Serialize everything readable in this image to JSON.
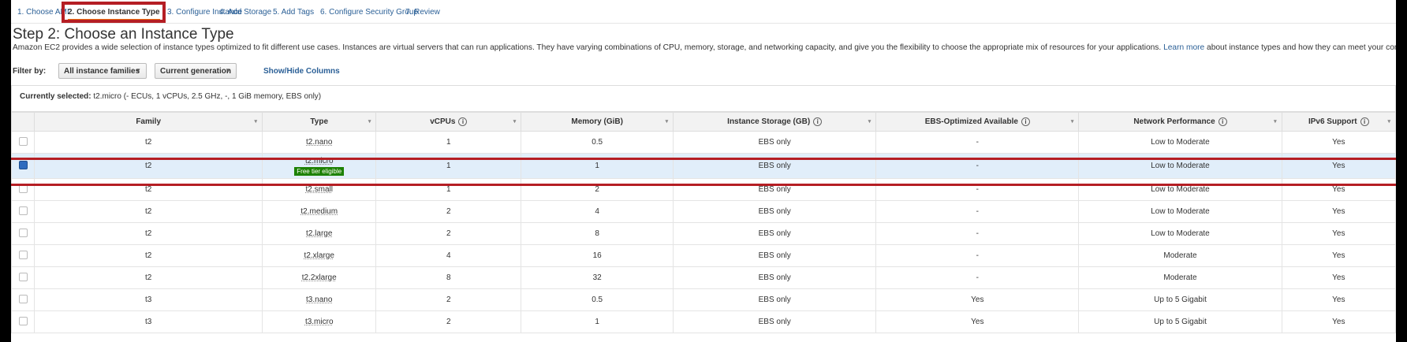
{
  "wizard": {
    "tabs": [
      {
        "label": "1. Choose AMI"
      },
      {
        "label": "2. Choose Instance Type"
      },
      {
        "label": "3. Configure Instance"
      },
      {
        "label": "4. Add Storage"
      },
      {
        "label": "5. Add Tags"
      },
      {
        "label": "6. Configure Security Group"
      },
      {
        "label": "7. Review"
      }
    ],
    "active_index": 1
  },
  "page": {
    "title": "Step 2: Choose an Instance Type",
    "description": "Amazon EC2 provides a wide selection of instance types optimized to fit different use cases. Instances are virtual servers that can run applications. They have varying combinations of CPU, memory, storage, and networking capacity, and give you the flexibility to choose the appropriate mix of resources for your applications.",
    "learn_more": "Learn more",
    "description_tail": "about instance types and how they can meet your computing needs."
  },
  "filter": {
    "label": "Filter by:",
    "family_select": "All instance families",
    "generation_select": "Current generation",
    "show_hide": "Show/Hide Columns"
  },
  "currently_selected": {
    "label": "Currently selected:",
    "value": "t2.micro (- ECUs, 1 vCPUs, 2.5 GHz, -, 1 GiB memory, EBS only)"
  },
  "table": {
    "columns": [
      "",
      "Family",
      "Type",
      "vCPUs",
      "Memory (GiB)",
      "Instance Storage (GB)",
      "EBS-Optimized Available",
      "Network Performance",
      "IPv6 Support"
    ],
    "rows": [
      {
        "checked": false,
        "family": "t2",
        "type": "t2.nano",
        "badge": "",
        "vcpus": "1",
        "memory": "0.5",
        "storage": "EBS only",
        "ebs": "-",
        "network": "Low to Moderate",
        "ipv6": "Yes"
      },
      {
        "checked": true,
        "family": "t2",
        "type": "t2.micro",
        "badge": "Free tier eligible",
        "vcpus": "1",
        "memory": "1",
        "storage": "EBS only",
        "ebs": "-",
        "network": "Low to Moderate",
        "ipv6": "Yes"
      },
      {
        "checked": false,
        "family": "t2",
        "type": "t2.small",
        "badge": "",
        "vcpus": "1",
        "memory": "2",
        "storage": "EBS only",
        "ebs": "-",
        "network": "Low to Moderate",
        "ipv6": "Yes"
      },
      {
        "checked": false,
        "family": "t2",
        "type": "t2.medium",
        "badge": "",
        "vcpus": "2",
        "memory": "4",
        "storage": "EBS only",
        "ebs": "-",
        "network": "Low to Moderate",
        "ipv6": "Yes"
      },
      {
        "checked": false,
        "family": "t2",
        "type": "t2.large",
        "badge": "",
        "vcpus": "2",
        "memory": "8",
        "storage": "EBS only",
        "ebs": "-",
        "network": "Low to Moderate",
        "ipv6": "Yes"
      },
      {
        "checked": false,
        "family": "t2",
        "type": "t2.xlarge",
        "badge": "",
        "vcpus": "4",
        "memory": "16",
        "storage": "EBS only",
        "ebs": "-",
        "network": "Moderate",
        "ipv6": "Yes"
      },
      {
        "checked": false,
        "family": "t2",
        "type": "t2.2xlarge",
        "badge": "",
        "vcpus": "8",
        "memory": "32",
        "storage": "EBS only",
        "ebs": "-",
        "network": "Moderate",
        "ipv6": "Yes"
      },
      {
        "checked": false,
        "family": "t3",
        "type": "t3.nano",
        "badge": "",
        "vcpus": "2",
        "memory": "0.5",
        "storage": "EBS only",
        "ebs": "Yes",
        "network": "Up to 5 Gigabit",
        "ipv6": "Yes"
      },
      {
        "checked": false,
        "family": "t3",
        "type": "t3.micro",
        "badge": "",
        "vcpus": "2",
        "memory": "1",
        "storage": "EBS only",
        "ebs": "Yes",
        "network": "Up to 5 Gigabit",
        "ipv6": "Yes"
      }
    ]
  },
  "colors": {
    "accent": "#ec7211",
    "link": "#2a5f96",
    "highlight": "#b51e24",
    "selected_row": "#e1eefa",
    "badge": "#1d8102"
  }
}
